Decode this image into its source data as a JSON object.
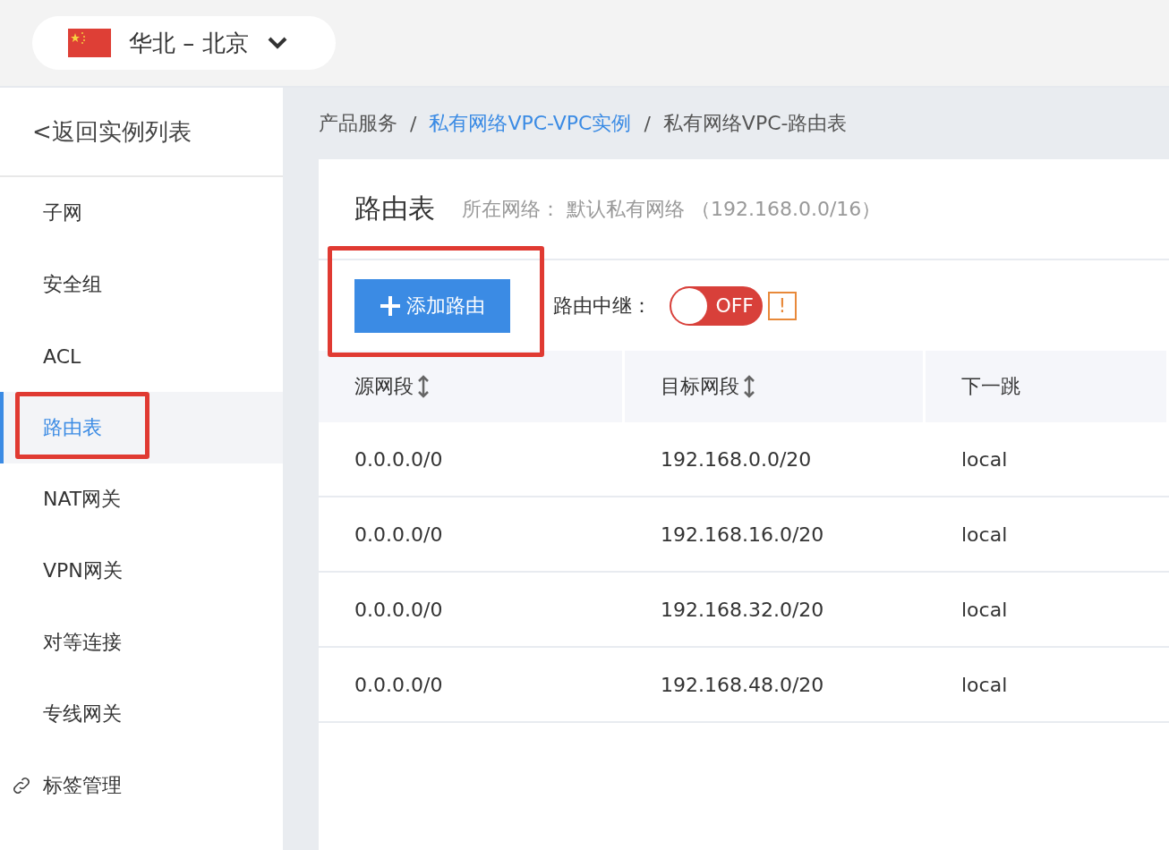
{
  "region_selector": {
    "label": "华北 – 北京"
  },
  "sidebar": {
    "back_link": "<返回实例列表",
    "items": [
      {
        "label": "子网",
        "selected": false,
        "highlighted": false,
        "kind": "plain"
      },
      {
        "label": "安全组",
        "selected": false,
        "highlighted": false,
        "kind": "plain"
      },
      {
        "label": "ACL",
        "selected": false,
        "highlighted": false,
        "kind": "plain"
      },
      {
        "label": "路由表",
        "selected": true,
        "highlighted": true,
        "kind": "plain"
      },
      {
        "label": "NAT网关",
        "selected": false,
        "highlighted": false,
        "kind": "plain"
      },
      {
        "label": "VPN网关",
        "selected": false,
        "highlighted": false,
        "kind": "plain"
      },
      {
        "label": "对等连接",
        "selected": false,
        "highlighted": false,
        "kind": "plain"
      },
      {
        "label": "专线网关",
        "selected": false,
        "highlighted": false,
        "kind": "plain"
      },
      {
        "label": "标签管理",
        "selected": false,
        "highlighted": false,
        "kind": "link"
      }
    ]
  },
  "breadcrumb_separator": "/",
  "breadcrumb": [
    {
      "label": "产品服务",
      "link": false
    },
    {
      "label": "私有网络VPC-VPC实例",
      "link": true
    },
    {
      "label": "私有网络VPC-路由表",
      "link": false
    }
  ],
  "page": {
    "title": "路由表",
    "network_label": "所在网络：",
    "network_value": "默认私有网络 （192.168.0.0/16）"
  },
  "toolbar": {
    "add_button": {
      "label": "添加路由",
      "highlighted": true
    },
    "relay_label": "路由中继：",
    "relay_toggle": {
      "on": false,
      "label": "OFF"
    },
    "warning": "!"
  },
  "table": {
    "columns": [
      {
        "label": "源网段",
        "sortable": true
      },
      {
        "label": "目标网段",
        "sortable": true
      },
      {
        "label": "下一跳",
        "sortable": false
      }
    ],
    "rows": [
      [
        "0.0.0.0/0",
        "192.168.0.0/20",
        "local"
      ],
      [
        "0.0.0.0/0",
        "192.168.16.0/20",
        "local"
      ],
      [
        "0.0.0.0/0",
        "192.168.32.0/20",
        "local"
      ],
      [
        "0.0.0.0/0",
        "192.168.48.0/20",
        "local"
      ]
    ]
  }
}
